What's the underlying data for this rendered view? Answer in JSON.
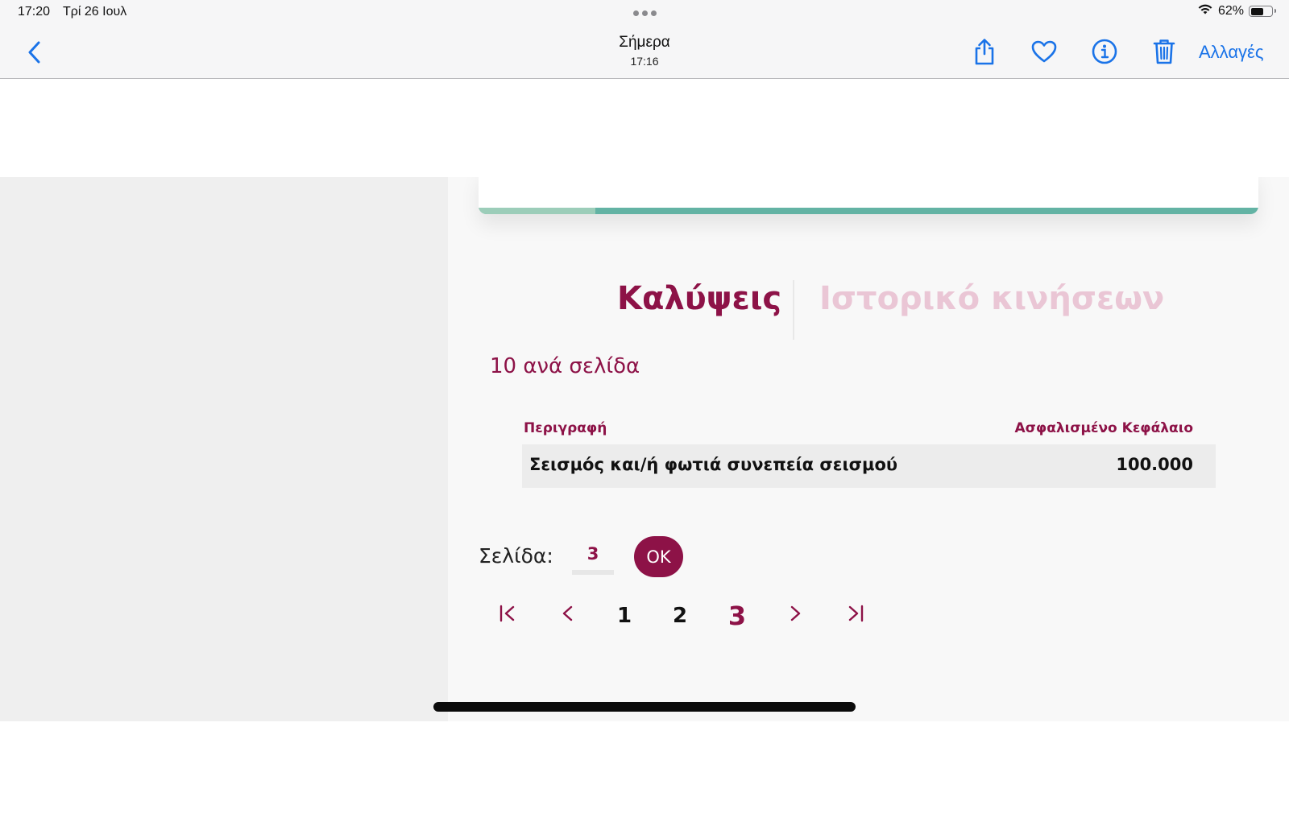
{
  "status_bar": {
    "time": "17:20",
    "date": "Τρί 26 Ιουλ",
    "battery": "62%",
    "battery_level": 0.62
  },
  "nav": {
    "title": "Σήμερα",
    "subtitle": "17:16",
    "edit_label": "Αλλαγές",
    "icons": [
      "back-chevron-icon",
      "share-icon",
      "heart-icon",
      "info-icon",
      "trash-icon"
    ],
    "accent_color": "#1a73e8"
  },
  "content": {
    "card_progress_segment": 0.15,
    "tabs": [
      {
        "label": "Καλύψεις",
        "active": true
      },
      {
        "label": "Ιστορικό κινήσεων",
        "active": false
      }
    ],
    "per_page": "10 ανά σελίδα",
    "table": {
      "headers": [
        "Περιγραφή",
        "Ασφαλισμένο Κεφάλαιο"
      ],
      "rows": [
        [
          "Σεισμός και/ή φωτιά συνεπεία σεισμού",
          "100.000"
        ]
      ]
    },
    "pagination": {
      "page_label": "Σελίδα:",
      "page_input_value": "3",
      "ok_label": "OK",
      "first_label": "|<",
      "prev_label": "<",
      "pages": [
        "1",
        "2",
        "3"
      ],
      "current_page": "3",
      "next_label": ">",
      "last_label": ">|"
    },
    "brand_color": "#8d1247"
  }
}
